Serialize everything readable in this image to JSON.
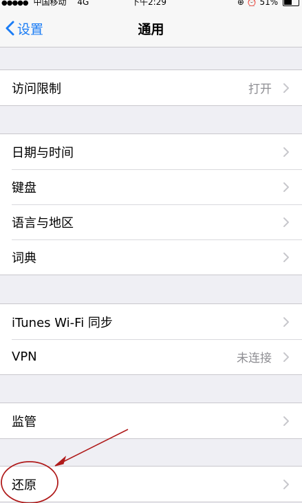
{
  "status_bar": {
    "signal": "●●●●●",
    "carrier": "中国移动",
    "network": "4G",
    "time": "下午2:29",
    "icons": [
      "orientation-lock-icon",
      "alarm-icon"
    ],
    "battery": "51%"
  },
  "nav": {
    "back_label": "设置",
    "title": "通用"
  },
  "groups": [
    [
      {
        "label": "访问限制",
        "value": "打开"
      }
    ],
    [
      {
        "label": "日期与时间",
        "value": ""
      },
      {
        "label": "键盘",
        "value": ""
      },
      {
        "label": "语言与地区",
        "value": ""
      },
      {
        "label": "词典",
        "value": ""
      }
    ],
    [
      {
        "label": "iTunes Wi-Fi 同步",
        "value": ""
      },
      {
        "label": "VPN",
        "value": "未连接"
      }
    ],
    [
      {
        "label": "监管",
        "value": ""
      }
    ],
    [
      {
        "label": "还原",
        "value": ""
      }
    ]
  ],
  "colors": {
    "accent": "#1a7cf5",
    "annotation": "#b01b1b"
  }
}
